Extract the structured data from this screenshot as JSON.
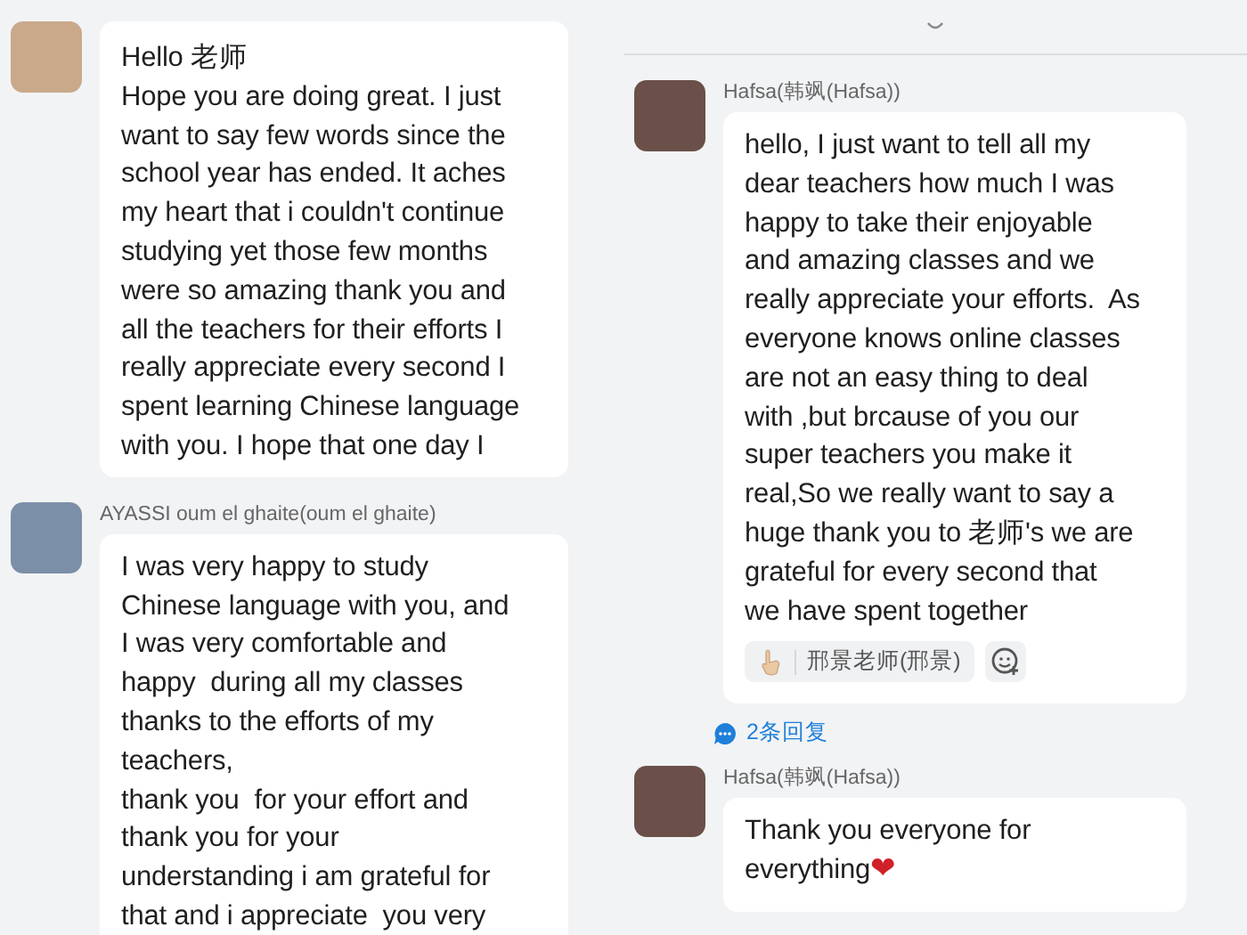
{
  "left_column": {
    "messages": [
      {
        "text": "Hello 老师\nHope you are doing great. I just\nwant to say few words since the\nschool year has ended. It aches\nmy heart that i couldn't continue\nstudying yet those few months\nwere so amazing thank you and\nall the teachers for their efforts I\nreally appreciate every second I\nspent learning Chinese language\nwith you. I hope that one day I"
      },
      {
        "sender": "AYASSI oum el ghaite(oum el ghaite)",
        "text": "I was very happy to study\nChinese language with you, and\nI was very comfortable and\nhappy  during all my classes\nthanks to the efforts of my\nteachers,\nthank you  for your effort and\nthank you for your\nunderstanding i am grateful for\nthat and i appreciate  you very"
      }
    ]
  },
  "right_column": {
    "messages": [
      {
        "sender": "Hafsa(韩飒(Hafsa))",
        "text": "hello, I just want to tell all my\ndear teachers how much I was\nhappy to take their enjoyable\nand amazing classes and we\nreally appreciate your efforts.  As\neveryone knows online classes\nare not an easy thing to deal\nwith ,but brcause of you our\nsuper teachers you make it\nreal,So we really want to say a\nhuge thank you to 老师's we are\ngrateful for every second that\nwe have spent together",
        "reactions": [
          {
            "user": "邢景老师(邢景)"
          }
        ],
        "replies": "2条回复"
      },
      {
        "sender": "Hafsa(韩飒(Hafsa))",
        "text": "Thank you everyone for\neverything",
        "emoji": "❤"
      }
    ]
  }
}
